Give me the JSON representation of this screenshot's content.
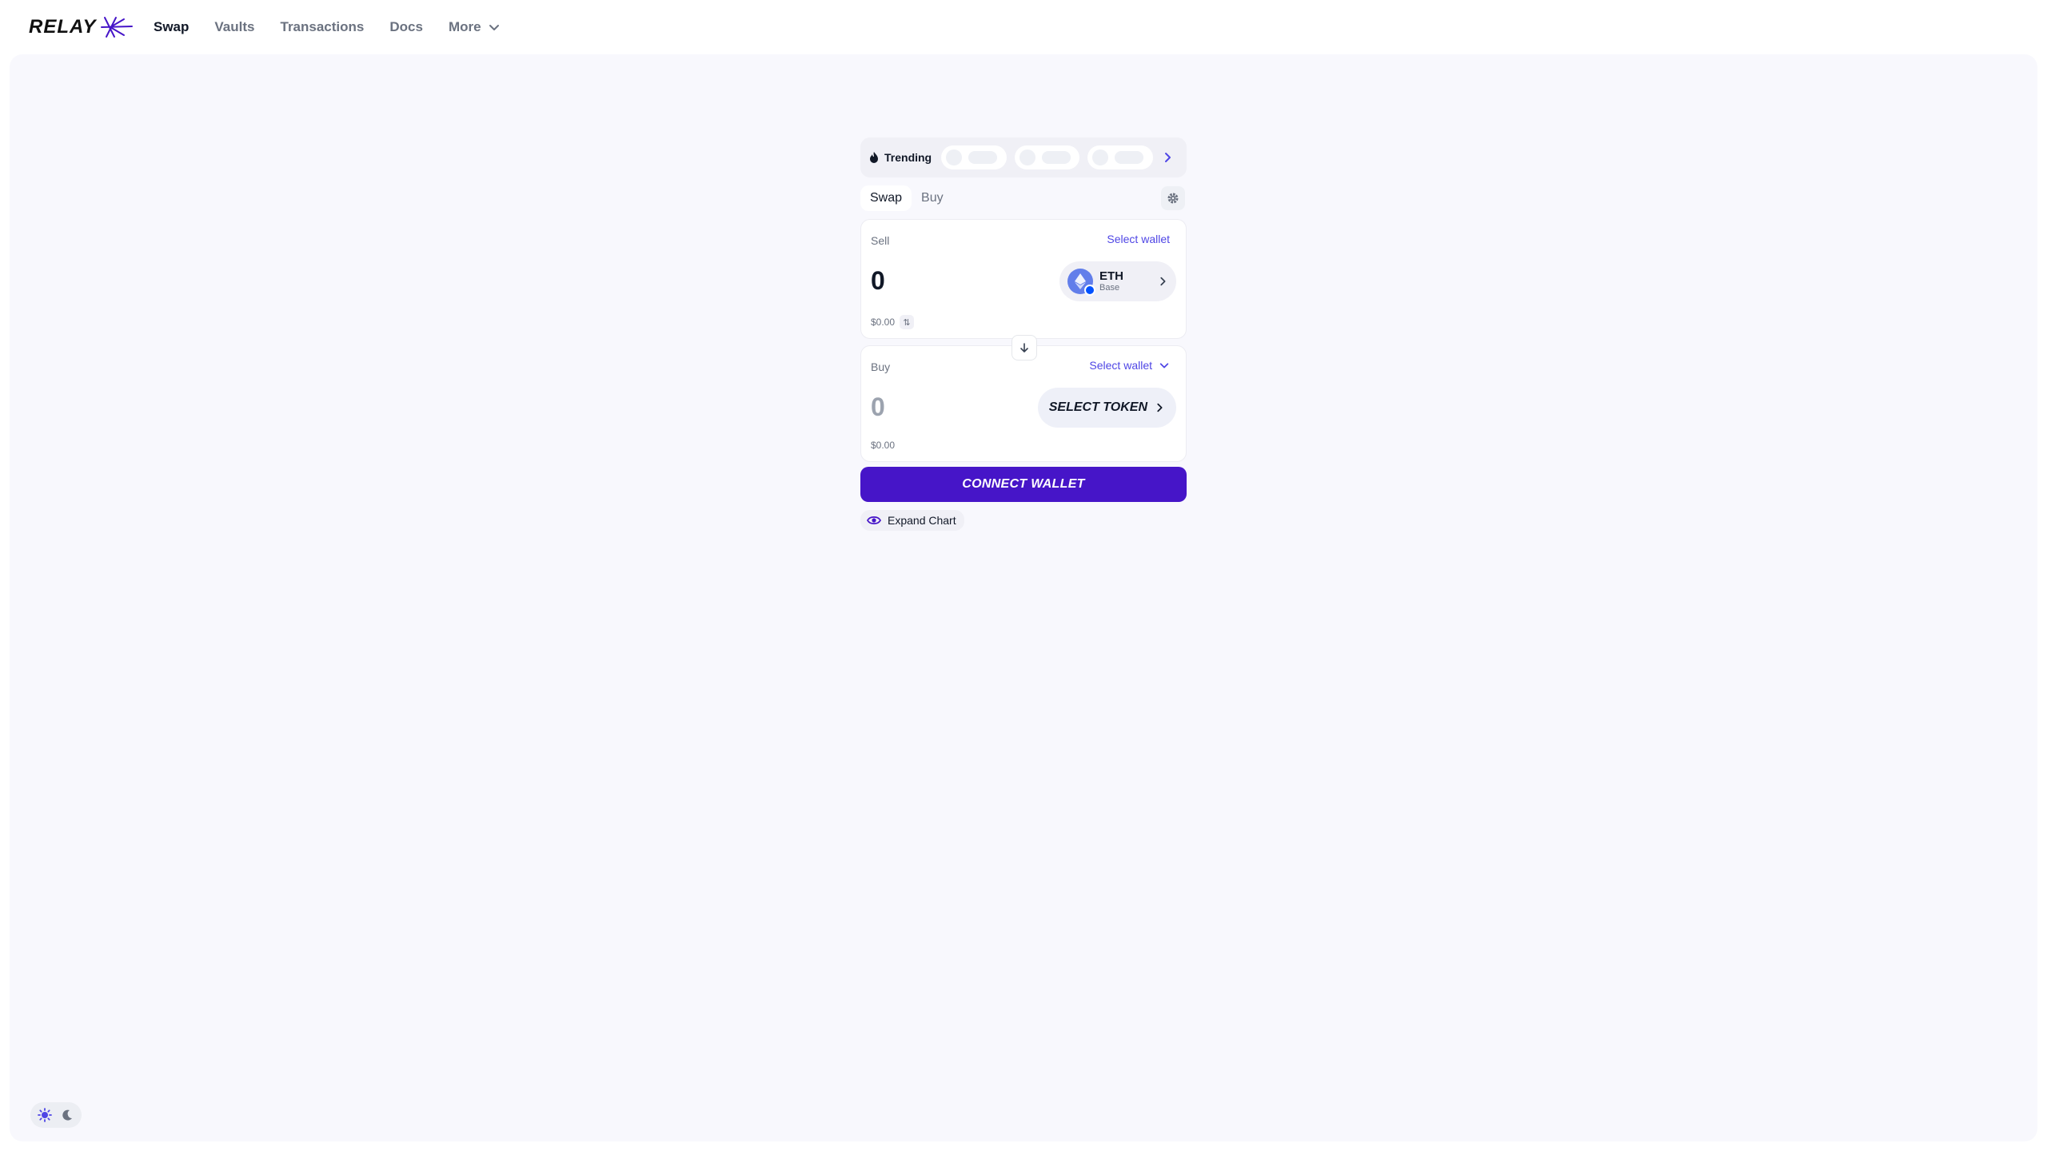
{
  "brand": {
    "name": "RELAY",
    "accent": "#4615c8",
    "link": "#4f46e5"
  },
  "nav": {
    "items": [
      {
        "label": "Swap",
        "active": true
      },
      {
        "label": "Vaults"
      },
      {
        "label": "Transactions"
      },
      {
        "label": "Docs"
      },
      {
        "label": "More",
        "icon": "chevron-down-icon"
      }
    ]
  },
  "trending": {
    "label": "Trending",
    "icon": "flame-icon",
    "next_icon": "chevron-right-icon"
  },
  "tabs": {
    "swap": "Swap",
    "buy": "Buy",
    "settings_icon": "gear-icon"
  },
  "sell": {
    "label": "Sell",
    "wallet": "Select wallet",
    "amount": "0",
    "usd": "$0.00",
    "token": {
      "symbol": "ETH",
      "chain": "Base"
    }
  },
  "buy": {
    "label": "Buy",
    "wallet": "Select wallet",
    "amount": "0",
    "usd": "$0.00",
    "select_token": "SELECT TOKEN"
  },
  "connect_wallet": "CONNECT WALLET",
  "expand_chart": "Expand Chart",
  "theme": {
    "light_icon": "sun-icon",
    "dark_icon": "moon-icon"
  }
}
